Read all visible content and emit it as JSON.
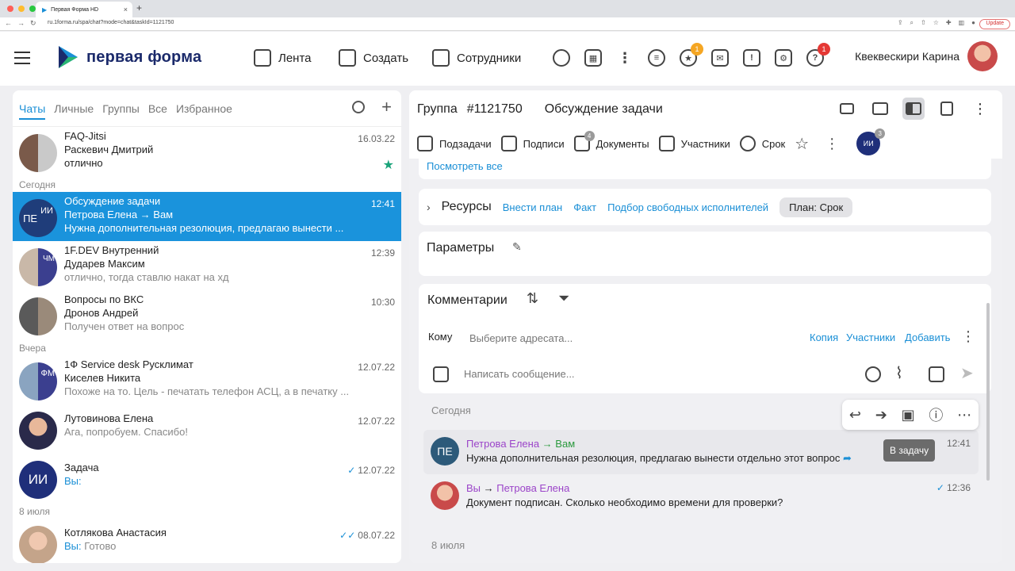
{
  "browser": {
    "tab_title": "Первая Форма HD",
    "url": "ru.1forma.ru/spa/chat?mode=chat&taskId=1121750",
    "update_label": "Update"
  },
  "header": {
    "logo_text": "первая форма",
    "nav": [
      {
        "label": "Лента",
        "icon": "feed-icon"
      },
      {
        "label": "Создать",
        "icon": "create-icon"
      },
      {
        "label": "Сотрудники",
        "icon": "employees-icon"
      }
    ],
    "badges": {
      "favorites": "1",
      "help": "1"
    },
    "user_name": "Квеквескири Карина"
  },
  "left": {
    "tabs": [
      "Чаты",
      "Личные",
      "Группы",
      "Все",
      "Избранное"
    ],
    "sections": {
      "today": "Сегодня",
      "yesterday": "Вчера",
      "july8": "8 июля"
    },
    "chats": [
      {
        "name": "FAQ-Jitsi",
        "sub": "Раскевич Дмитрий",
        "msg": "отлично",
        "time": "16.03.22"
      },
      {
        "name": "Обсуждение задачи",
        "sub": "Петрова Елена → Вам",
        "msg": "Нужна дополнительная резолюция,  предлагаю вынести ...",
        "time": "12:41",
        "avatar_a": "ИИ",
        "avatar_b": "ПЕ"
      },
      {
        "name": "1F.DEV Внутренний",
        "sub": "Дударев Максим",
        "msg": "отлично, тогда ставлю накат на хд",
        "time": "12:39",
        "avatar_a": "ЧМ"
      },
      {
        "name": "Вопросы по ВКС",
        "sub": "Дронов Андрей",
        "msg": "Получен ответ на вопрос",
        "time": "10:30"
      },
      {
        "name": "1Ф Service desk Русклимат",
        "sub": "Киселев Никита",
        "msg": "Похоже на то. Цель - печатать телефон АСЦ, а в печатку ...",
        "time": "12.07.22",
        "avatar_a": "ФМ"
      },
      {
        "name": "Лутовинова Елена",
        "msg": "Ага, попробуем. Спасибо!",
        "time": "12.07.22"
      },
      {
        "name": "Задача",
        "msg": "Вы:",
        "time": "12.07.22",
        "avatar_a": "ИИ"
      },
      {
        "name": "Котлякова Анастасия",
        "msg": "Вы: Готово",
        "msg_prefix": "Вы:",
        "msg_rest": " Готово",
        "time": "08.07.22"
      }
    ]
  },
  "right": {
    "group_label": "Группа",
    "task_id": "#1121750",
    "title": "Обсуждение задачи",
    "tools": [
      {
        "label": "Подзадачи"
      },
      {
        "label": "Подписи"
      },
      {
        "label": "Документы",
        "badge": "4"
      },
      {
        "label": "Участники"
      },
      {
        "label": "Срок"
      }
    ],
    "members": {
      "a": "ИИ",
      "b": "ПЕ",
      "count": "3"
    },
    "see_all": "Посмотреть все",
    "resources": {
      "title": "Ресурсы",
      "links": [
        "Внести план",
        "Факт",
        "Подбор свободных исполнителей"
      ],
      "pill": "План: Срок"
    },
    "params_title": "Параметры",
    "comments": {
      "title": "Комментарии",
      "to_label": "Кому",
      "to_placeholder": "Выберите адресата...",
      "to_links": [
        "Копия",
        "Участники",
        "Добавить"
      ],
      "msg_placeholder": "Написать сообщение..."
    },
    "feed": {
      "today": "Сегодня",
      "july8": "8 июля",
      "messages": [
        {
          "avatar": "ПЕ",
          "from": "Петрова Елена",
          "arrow": " → ",
          "to": "Вам",
          "text": "Нужна дополнительная резолюция,  предлагаю вынести отдельно этот вопрос",
          "time": "12:41"
        },
        {
          "from": "Вы",
          "arrow": " → ",
          "to": "Петрова Елена",
          "text": "Документ подписан. Сколько необходимо времени для проверки?",
          "time": "12:36"
        }
      ]
    },
    "tooltip": "В задачу"
  }
}
